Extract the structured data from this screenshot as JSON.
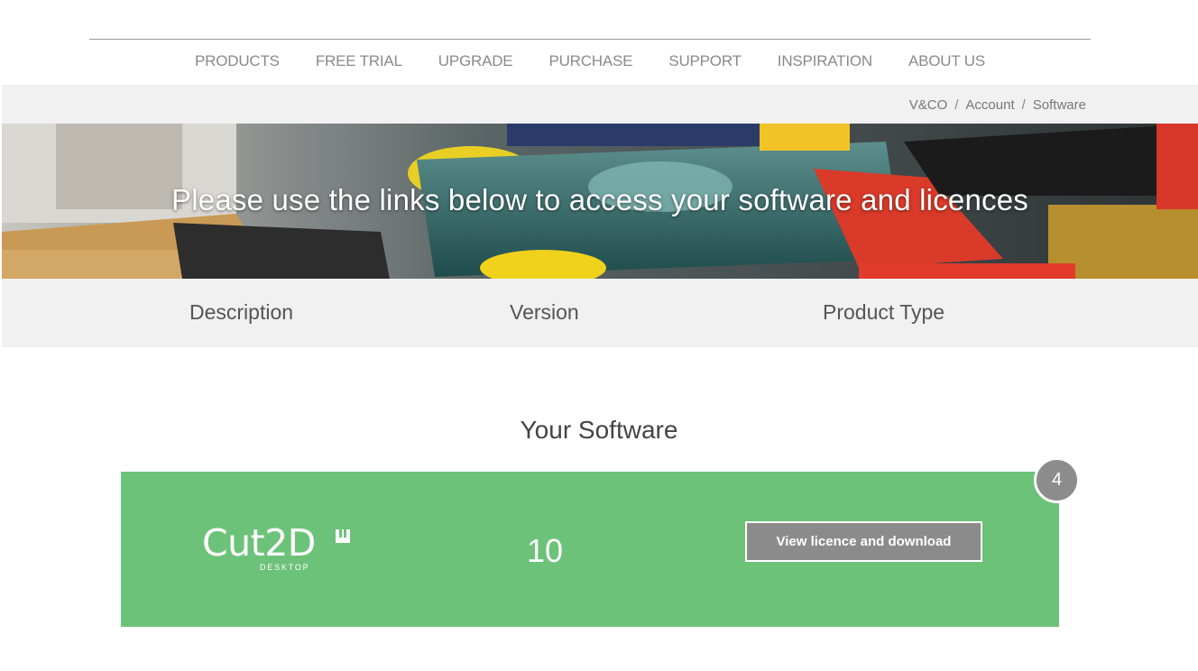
{
  "nav": {
    "items": [
      "PRODUCTS",
      "FREE TRIAL",
      "UPGRADE",
      "PURCHASE",
      "SUPPORT",
      "INSPIRATION",
      "ABOUT US"
    ]
  },
  "breadcrumb": {
    "items": [
      "V&CO",
      "Account",
      "Software"
    ],
    "separator": "/"
  },
  "hero": {
    "title": "Please use the links below to access your software and licences"
  },
  "table_header": {
    "columns": [
      "Description",
      "Version",
      "Product Type"
    ]
  },
  "section": {
    "title": "Your Software"
  },
  "software": {
    "logo_text": "Cut2D",
    "logo_sub": "DESKTOP",
    "version": "10",
    "button_label": "View licence and download",
    "badge_count": "4",
    "card_color": "#6dc27a"
  }
}
